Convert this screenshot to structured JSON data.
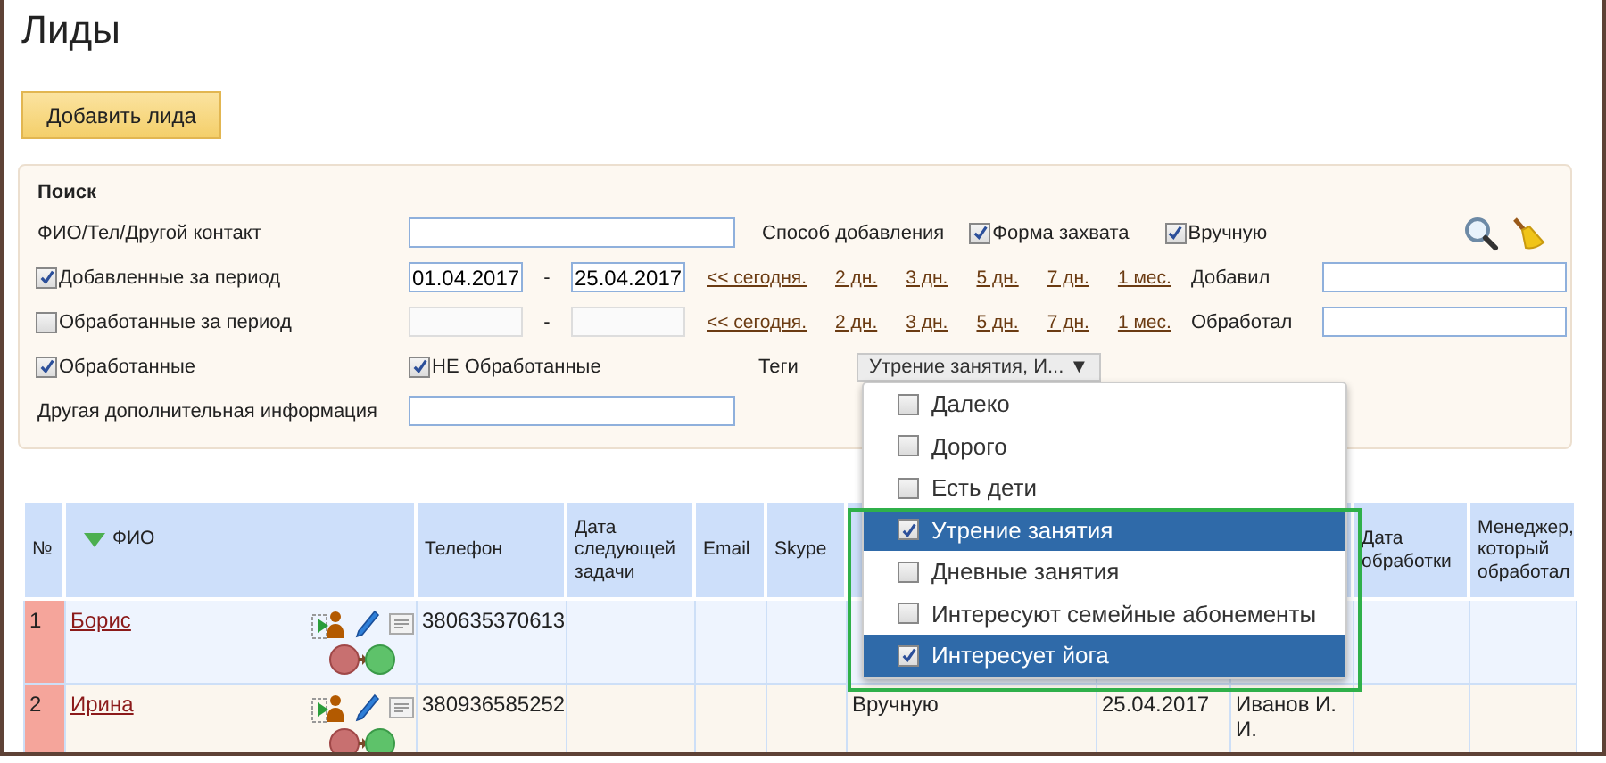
{
  "page": {
    "title": "Лиды"
  },
  "add_button": "Добавить лида",
  "search": {
    "heading": "Поиск",
    "contact": {
      "label": "ФИО/Тел/Другой контакт"
    },
    "method": {
      "label": "Способ добавления",
      "options": [
        {
          "label": "Форма захвата",
          "checked": true
        },
        {
          "label": "Вручную",
          "checked": true
        }
      ]
    },
    "periods": [
      {
        "label": "Добавленные за период",
        "checked": true,
        "from": "01.04.2017",
        "to": "25.04.2017",
        "separator": "-",
        "links": [
          "<< сегодня.",
          "2 дн.",
          "3 дн.",
          "5 дн.",
          "7 дн.",
          "1 мес."
        ],
        "person_label": "Добавил"
      },
      {
        "label": "Обработанные за период",
        "checked": false,
        "separator": "-",
        "links": [
          "<< сегодня.",
          "2 дн.",
          "3 дн.",
          "5 дн.",
          "7 дн.",
          "1 мес."
        ],
        "person_label": "Обработал"
      }
    ],
    "processed": [
      {
        "label": "Обработанные",
        "checked": true
      },
      {
        "label": "НЕ Обработанные",
        "checked": true
      }
    ],
    "tags": {
      "label": "Теги",
      "value": "Утрение занятия, И...",
      "caret": "▼"
    },
    "other_info": {
      "label": "Другая дополнительная информация"
    }
  },
  "tags_dropdown": {
    "options": [
      {
        "label": "Далеко",
        "checked": false
      },
      {
        "label": "Дорого",
        "checked": false
      },
      {
        "label": "Есть дети",
        "checked": false
      },
      {
        "label": "Утрение занятия",
        "checked": true
      },
      {
        "label": "Дневные занятия",
        "checked": false
      },
      {
        "label": "Интересуют семейные абонементы",
        "checked": false
      },
      {
        "label": "Интересует йога",
        "checked": true
      }
    ]
  },
  "table": {
    "columns": [
      {
        "kind": "text",
        "label": "№"
      },
      {
        "kind": "text",
        "label": "ФИО",
        "sorted": true
      },
      {
        "kind": "text",
        "label": "Телефон"
      },
      {
        "kind": "text",
        "label": "Дата следующей задачи"
      },
      {
        "kind": "text",
        "label": "Email"
      },
      {
        "kind": "text",
        "label": "Skype"
      },
      {
        "kind": "blank"
      },
      {
        "kind": "blank"
      },
      {
        "kind": "blank"
      },
      {
        "kind": "text",
        "label": "Дата обработки"
      },
      {
        "kind": "text",
        "label": "Менеджер, который обработал"
      }
    ],
    "rows": [
      {
        "number": "1",
        "name": "Борис",
        "phone": "380635370613"
      },
      {
        "number": "2",
        "name": "Ирина",
        "phone": "380936585252",
        "column_7": "Вручную",
        "column_8": "25.04.2017",
        "column_9": "Иванов И. И."
      }
    ]
  }
}
